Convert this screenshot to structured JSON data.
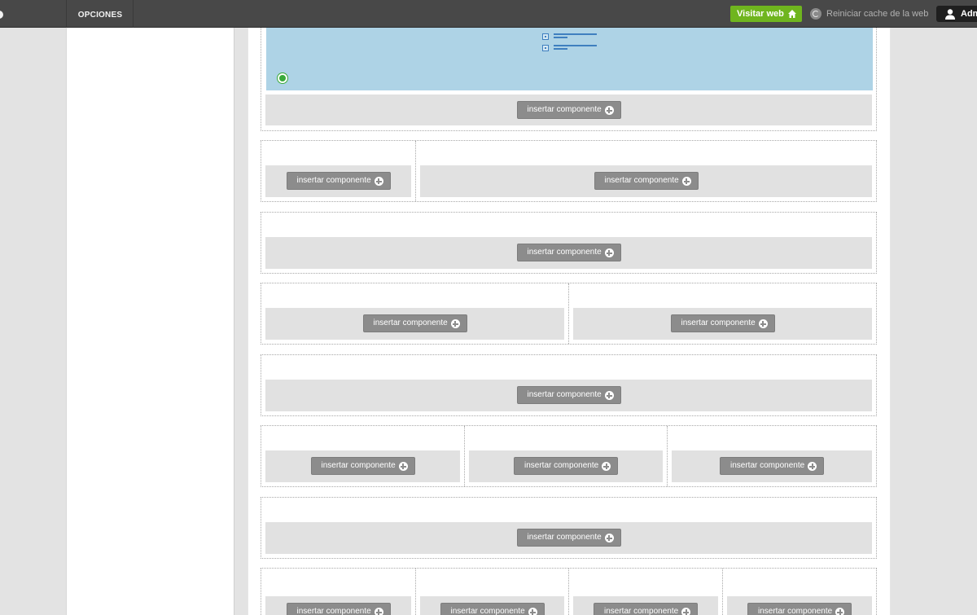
{
  "topbar": {
    "menu_label": "OPCIONES",
    "visit_label": "Visitar web",
    "cache_label": "Reiniciar cache de la web",
    "user_label": "Adm"
  },
  "insert_label": "insertar componente",
  "colors": {
    "topbar": "#484848",
    "visit_button": "#6fb51e",
    "preview_blue": "#aed3e6",
    "insert_button": "#8c8c8c",
    "slot_gray": "#e1e1e1"
  },
  "rows": [
    {
      "columns": 2
    },
    {
      "columns": 1
    },
    {
      "columns": 2
    },
    {
      "columns": 1
    },
    {
      "columns": 3
    },
    {
      "columns": 1
    },
    {
      "columns": 4
    }
  ]
}
